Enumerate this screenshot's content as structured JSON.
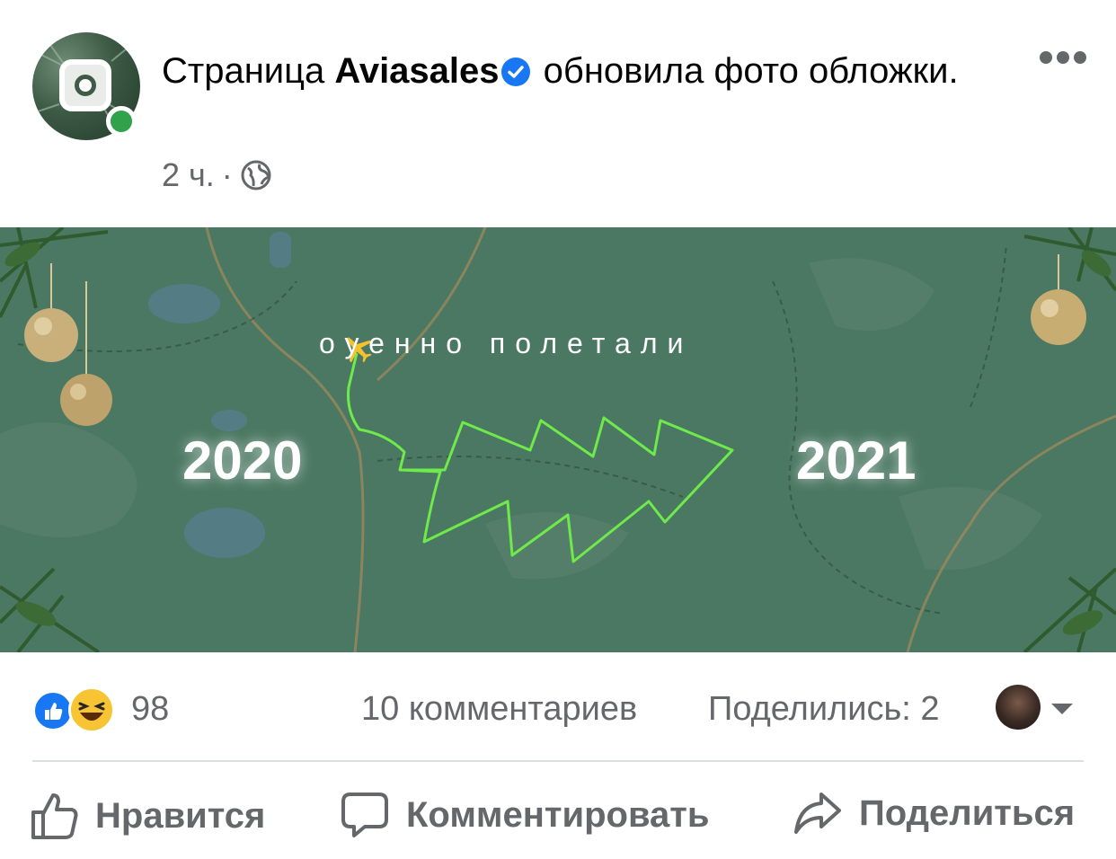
{
  "post": {
    "headline_prefix": "Страница",
    "page_name": "Aviasales",
    "headline_suffix": "обновила фото обложки.",
    "time": "2 ч.",
    "separator": "·"
  },
  "cover": {
    "tagline": "оуенно полетали",
    "year_start": "2020",
    "year_end": "2021"
  },
  "stats": {
    "reactions_count": "98",
    "comments": "10 комментариев",
    "shares": "Поделились: 2"
  },
  "actions": {
    "like": "Нравится",
    "comment": "Комментировать",
    "share": "Поделиться"
  },
  "icons": {
    "verified": "verified-badge-icon",
    "privacy": "globe-icon",
    "menu": "more-dots-icon",
    "like": "thumbs-up-icon",
    "comment": "speech-bubble-icon",
    "share": "share-arrow-icon"
  },
  "colors": {
    "facebook_blue": "#1877f2",
    "online_green": "#31a24c",
    "cover_green": "#4b7863",
    "route_green": "#6eea4a",
    "secondary_text": "#65676b"
  }
}
